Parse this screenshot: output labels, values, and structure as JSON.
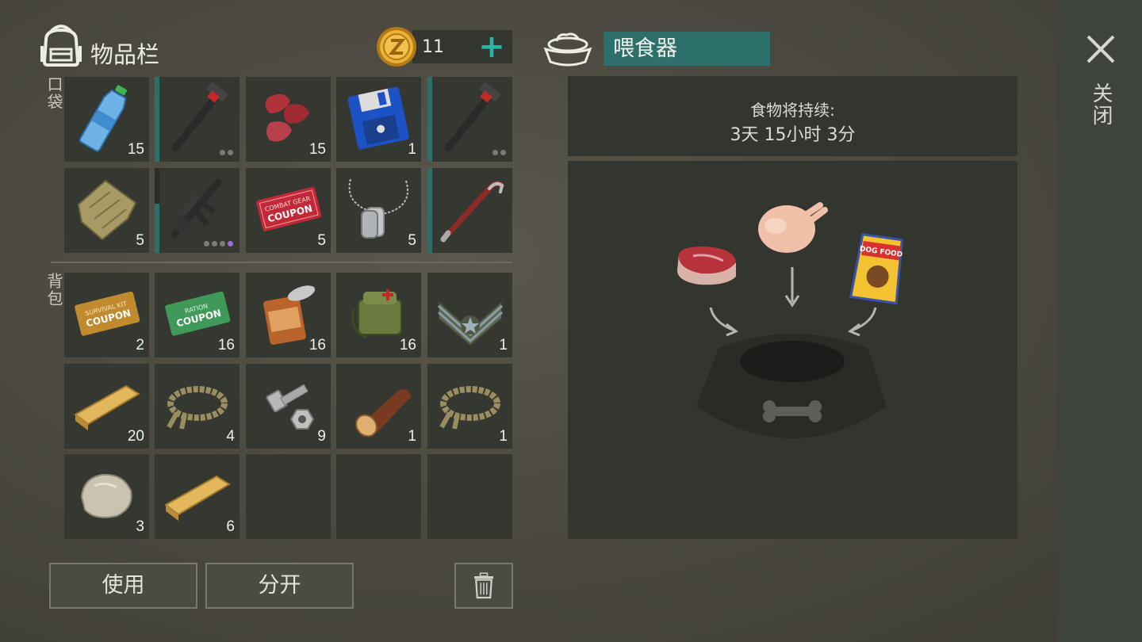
{
  "header": {
    "title": "物品栏",
    "coins": "11",
    "add_symbol": "+"
  },
  "sections": {
    "pocket_label": "口袋",
    "backpack_label": "背包"
  },
  "pocket_slots": [
    {
      "item": "water-bottle",
      "count": "15"
    },
    {
      "item": "pipe-wrench",
      "count": "",
      "durability": "full",
      "dots": 2
    },
    {
      "item": "raw-meat-strips",
      "count": "15"
    },
    {
      "item": "floppy-disk",
      "count": "1"
    },
    {
      "item": "pipe-wrench",
      "count": "",
      "durability": "full",
      "dots": 2
    },
    {
      "item": "cloth-rag",
      "count": "5"
    },
    {
      "item": "assault-rifle",
      "count": "",
      "durability": "half",
      "dots": 4
    },
    {
      "item": "combat-gear-coupon",
      "count": "5",
      "text": "COMBAT GEAR COUPON"
    },
    {
      "item": "dog-tags",
      "count": "5"
    },
    {
      "item": "crowbar",
      "count": "",
      "durability": "full"
    }
  ],
  "backpack_slots": [
    {
      "item": "survival-kit-coupon",
      "count": "2",
      "text": "SURVIVAL KIT COUPON"
    },
    {
      "item": "ration-coupon",
      "count": "16",
      "text": "RATION COUPON"
    },
    {
      "item": "canned-food",
      "count": "16"
    },
    {
      "item": "first-aid-bag",
      "count": "16"
    },
    {
      "item": "rank-chevron",
      "count": "1"
    },
    {
      "item": "wooden-plank",
      "count": "20"
    },
    {
      "item": "rope",
      "count": "4"
    },
    {
      "item": "bolt-and-nut",
      "count": "9"
    },
    {
      "item": "log",
      "count": "1"
    },
    {
      "item": "rope",
      "count": "1"
    },
    {
      "item": "stone",
      "count": "3"
    },
    {
      "item": "wooden-plank",
      "count": "6"
    },
    {
      "item": "",
      "count": ""
    },
    {
      "item": "",
      "count": ""
    },
    {
      "item": "",
      "count": ""
    }
  ],
  "buttons": {
    "use": "使用",
    "split": "分开"
  },
  "feeder": {
    "title": "喂食器",
    "duration_label": "食物将持续:",
    "duration_value": "3天 15小时 3分",
    "food_icons": [
      "steak",
      "raw-chicken",
      "dog-food-bag"
    ],
    "dog_food_text": "DOG FOOD"
  },
  "close": {
    "label": "关闭"
  },
  "colors": {
    "accent": "#2d6f6a",
    "plus": "#2bb3a5",
    "rare_dot": "#a36bd6"
  }
}
